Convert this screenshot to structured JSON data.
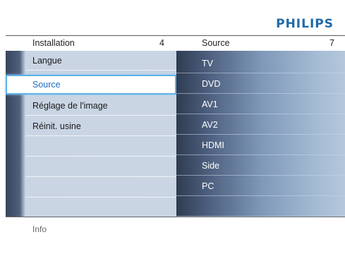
{
  "brand": "PHILIPS",
  "header": {
    "left_title": "Installation",
    "left_count": "4",
    "right_title": "Source",
    "right_count": "7"
  },
  "left_menu": {
    "items": [
      {
        "label": "Langue"
      },
      {
        "label": "Source"
      },
      {
        "label": "Réglage de l'image"
      },
      {
        "label": "Réinit. usine"
      },
      {
        "label": ""
      },
      {
        "label": ""
      },
      {
        "label": ""
      },
      {
        "label": ""
      }
    ],
    "selected": "Source"
  },
  "right_menu": {
    "items": [
      {
        "label": "TV"
      },
      {
        "label": "DVD"
      },
      {
        "label": "AV1"
      },
      {
        "label": "AV2"
      },
      {
        "label": "HDMI"
      },
      {
        "label": "Side"
      },
      {
        "label": "PC"
      },
      {
        "label": ""
      }
    ]
  },
  "info": "Info",
  "colors": {
    "brand": "#1f6aa8",
    "selected_text": "#1f6fc0",
    "selected_border": "#5fb0e8"
  }
}
